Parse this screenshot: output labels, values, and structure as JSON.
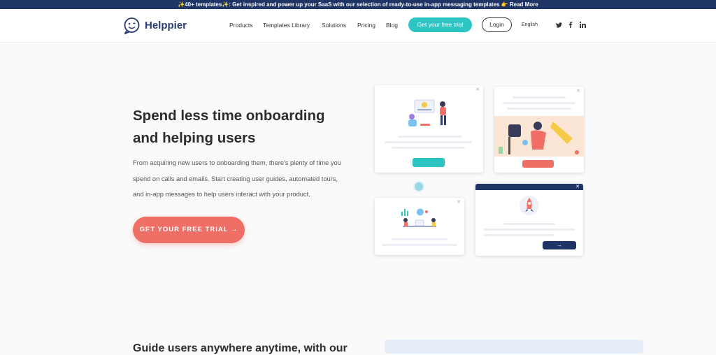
{
  "announcement": {
    "emoji": "✨",
    "bold": "40+ templates",
    "text": ": Get inspired and power up your SaaS with our selection of ready-to-use in-app messaging templates 👉 Read More"
  },
  "nav": {
    "logo": "Helppier",
    "items": [
      "Products",
      "Templates Library",
      "Solutions",
      "Pricing",
      "Blog"
    ],
    "trial": "Get your free trial",
    "login": "Login",
    "language": "English",
    "social": [
      "twitter-icon",
      "facebook-icon",
      "linkedin-icon"
    ]
  },
  "hero": {
    "headline": "Spend less time onboarding and helping users",
    "description": "From acquiring new users to onboarding them, there's plenty of time you spend on calls and emails. Start creating user guides, automated tours, and in-app messages to help users interact with your product.",
    "cta": "GET YOUR FREE TRIAL →"
  },
  "section2": {
    "headline": "Guide users anywhere anytime, with our"
  },
  "colors": {
    "navy": "#1f3566",
    "teal": "#2fc4c4",
    "coral": "#ef6e65"
  }
}
